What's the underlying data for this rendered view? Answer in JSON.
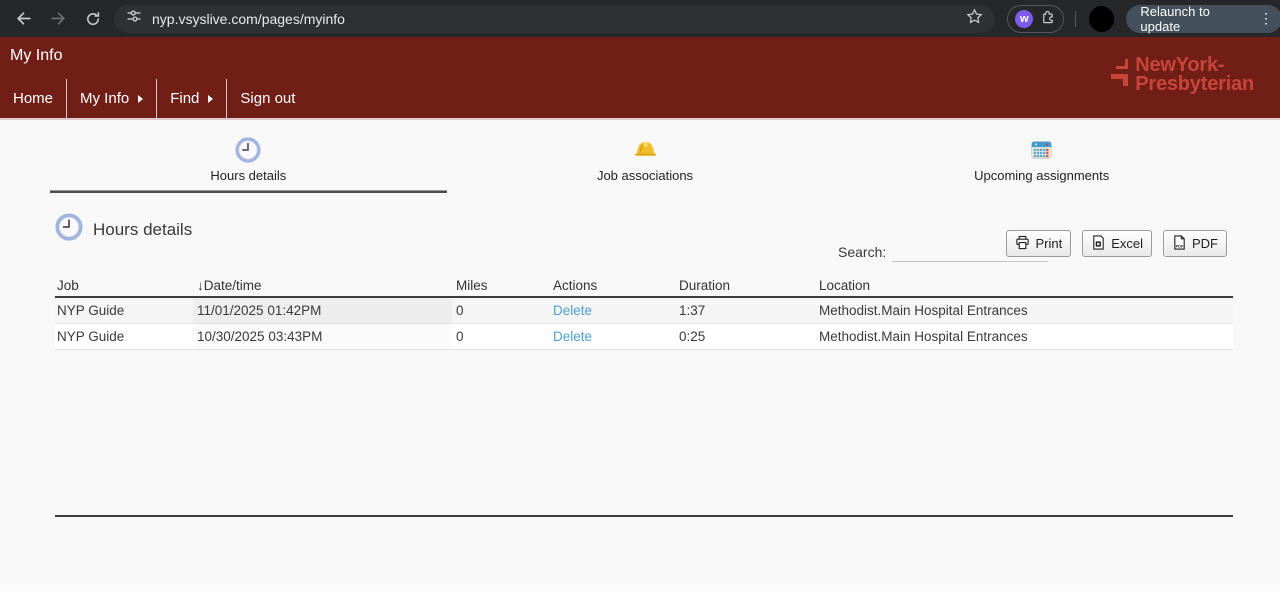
{
  "browser": {
    "url": "nyp.vsyslive.com/pages/myinfo",
    "relaunch_label": "Relaunch to update",
    "extension_glyph": "w"
  },
  "header": {
    "page_title": "My Info",
    "logo": {
      "line1": "NewYork-",
      "line2": "Presbyterian"
    },
    "nav": [
      {
        "label": "Home"
      },
      {
        "label": "My Info"
      },
      {
        "label": "Find"
      },
      {
        "label": "Sign out"
      }
    ]
  },
  "tabs": [
    {
      "label": "Hours details",
      "icon": "clock-icon",
      "active": true
    },
    {
      "label": "Job associations",
      "icon": "hardhat-icon",
      "active": false
    },
    {
      "label": "Upcoming assignments",
      "icon": "calendar-icon",
      "active": false
    }
  ],
  "section": {
    "title": "Hours details"
  },
  "toolbar": {
    "search_label": "Search:",
    "search_value": "",
    "buttons": [
      {
        "label": "Print",
        "icon": "printer-icon"
      },
      {
        "label": "Excel",
        "icon": "excel-icon"
      },
      {
        "label": "PDF",
        "icon": "pdf-icon"
      }
    ]
  },
  "table": {
    "columns": [
      "Job",
      "Date/time",
      "Miles",
      "Actions",
      "Duration",
      "Location"
    ],
    "sort": {
      "column": "Date/time",
      "direction": "descending"
    },
    "rows": [
      {
        "job": "NYP Guide",
        "datetime": "11/01/2025 01:42PM",
        "miles": "0",
        "action": "Delete",
        "duration": "1:37",
        "location": "Methodist.Main Hospital Entrances"
      },
      {
        "job": "NYP Guide",
        "datetime": "10/30/2025 03:43PM",
        "miles": "0",
        "action": "Delete",
        "duration": "0:25",
        "location": "Methodist.Main Hospital Entrances"
      }
    ]
  },
  "colors": {
    "browser_toolbar_bg": "#26272B",
    "header_bg": "#711E17",
    "logo_red": "#C8453C",
    "link_blue": "#4BA0D3",
    "content_bg": "#F8F8F8"
  }
}
